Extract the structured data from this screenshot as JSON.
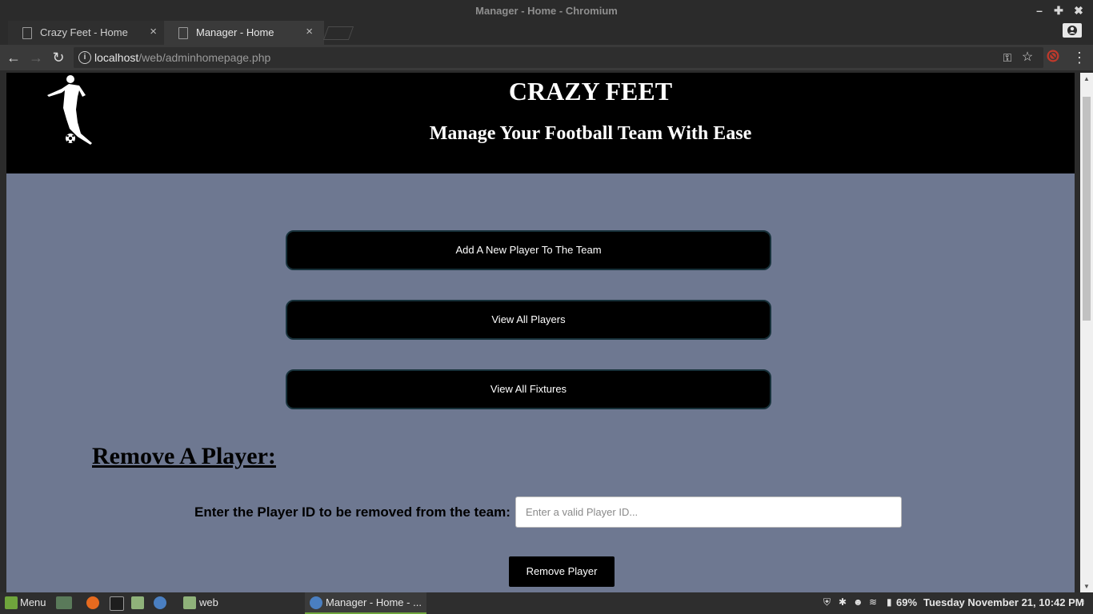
{
  "window": {
    "title": "Manager - Home - Chromium"
  },
  "tabs": [
    {
      "label": "Crazy Feet - Home"
    },
    {
      "label": "Manager - Home"
    }
  ],
  "address_bar": {
    "host": "localhost",
    "path": "/web/adminhomepage.php"
  },
  "page": {
    "site_title": "CRAZY FEET",
    "tagline": "Manage Your Football Team With Ease",
    "nav_buttons": [
      {
        "label": "Add A New Player To The Team"
      },
      {
        "label": "View All Players"
      },
      {
        "label": "View All Fixtures"
      }
    ],
    "remove_section": {
      "heading": "Remove A Player:",
      "label": "Enter the Player ID to be removed from the team:",
      "input_placeholder": "Enter a valid Player ID...",
      "input_value": "",
      "button_label": "Remove Player"
    }
  },
  "taskbar": {
    "menu_label": "Menu",
    "folder_label": "web",
    "active_window": "Manager - Home - ...",
    "battery": "69%",
    "clock": "Tuesday November 21, 10:42 PM"
  },
  "colors": {
    "page_background": "#6e7891",
    "header_background": "#000000",
    "button_background": "#000000",
    "accent_green": "#6fa53c"
  }
}
